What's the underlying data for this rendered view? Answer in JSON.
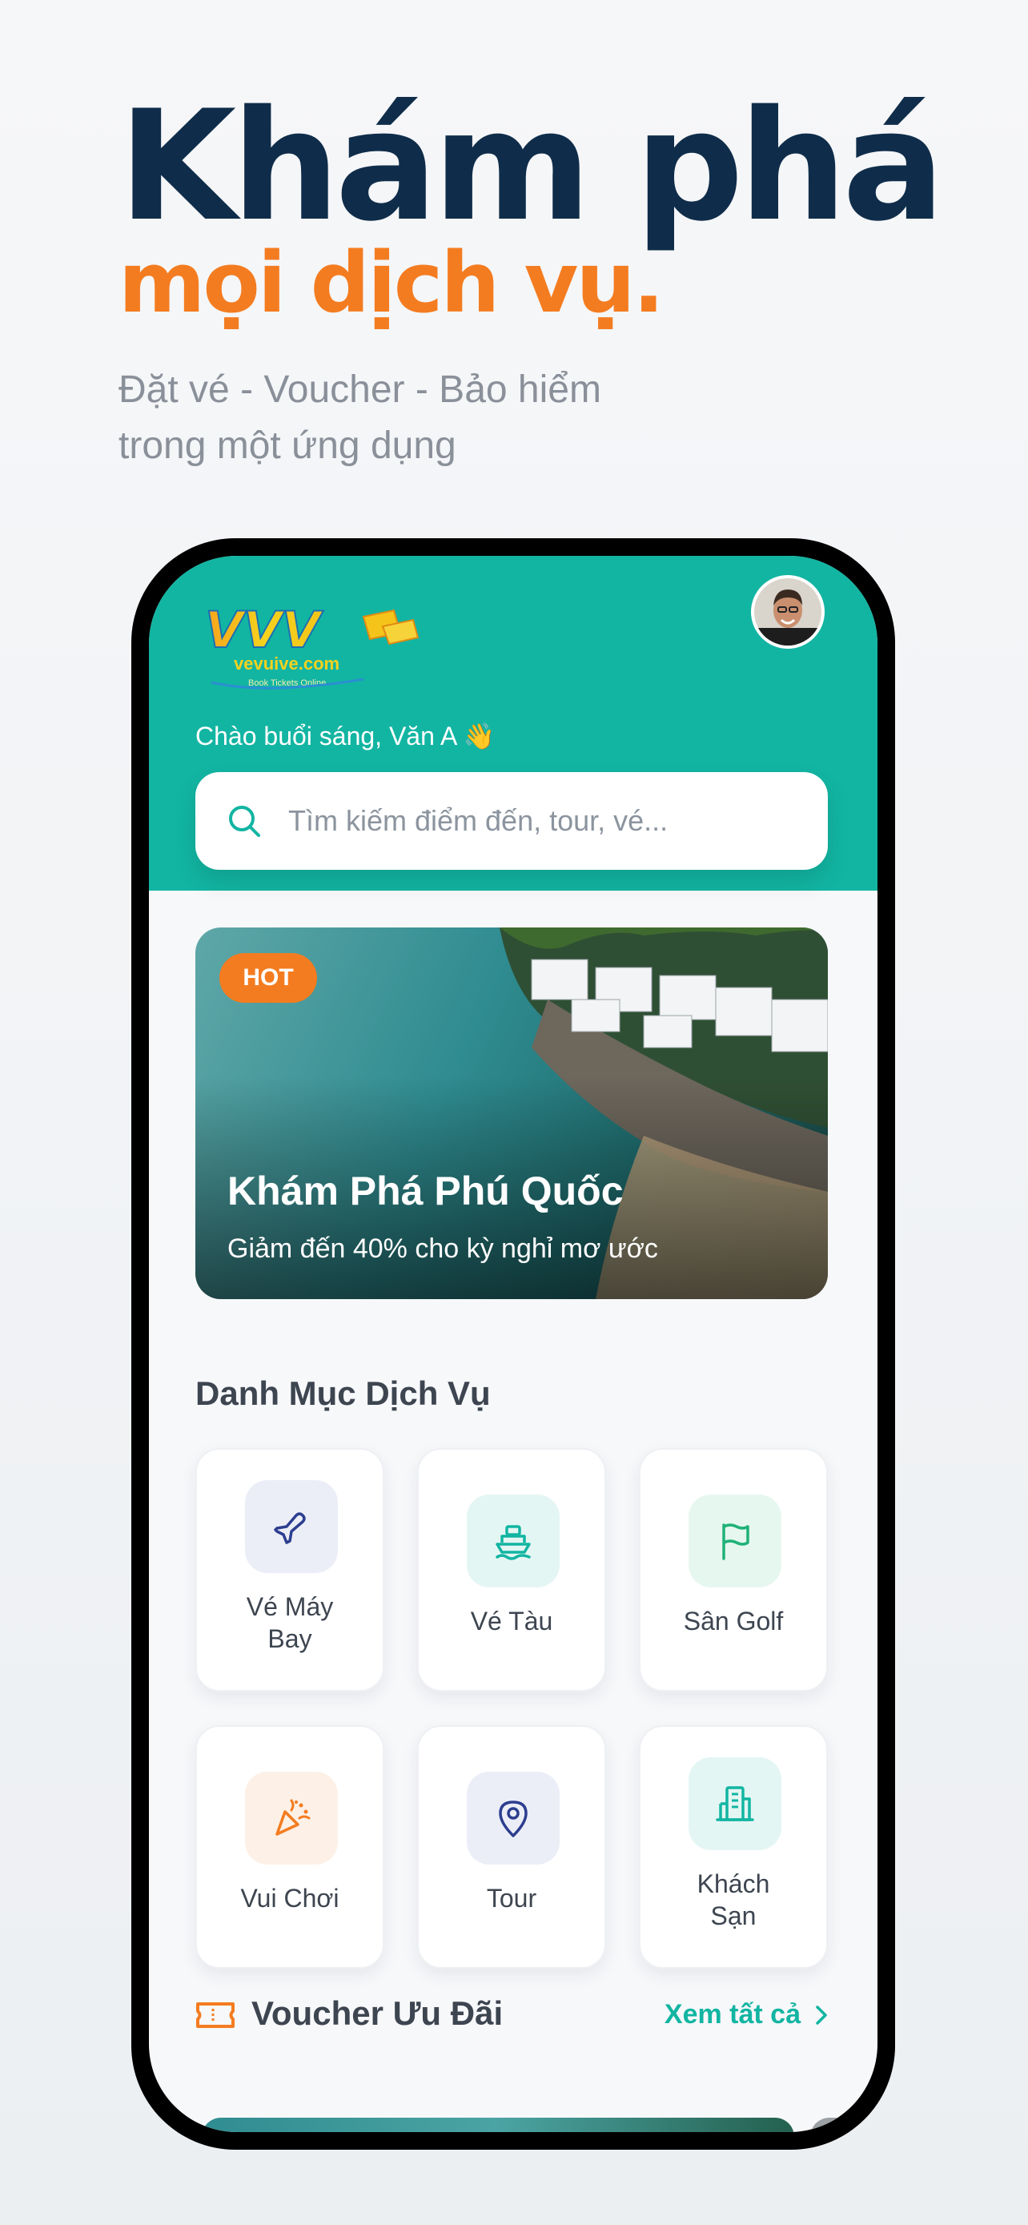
{
  "hero": {
    "title": "Khám phá",
    "subtitle": "mọi dịch vụ.",
    "description_line1": "Đặt vé - Voucher - Bảo hiểm",
    "description_line2": "trong một ứng dụng"
  },
  "app": {
    "logo_text": "VVV",
    "logo_brand": "vevuive.com",
    "logo_tagline": "Book Tickets Online",
    "greeting": "Chào buổi sáng, Văn A 👋",
    "search_placeholder": "Tìm kiếm điểm đến, tour, vé...",
    "banner": {
      "badge": "HOT",
      "title": "Khám Phá Phú Quốc",
      "subtitle": "Giảm đến 40% cho kỳ nghỉ mơ ước"
    },
    "categories_title": "Danh Mục Dịch Vụ",
    "categories": [
      {
        "label_line1": "Vé Máy",
        "label_line2": "Bay",
        "icon": "airplane-icon",
        "tile_color": "#eceef7",
        "icon_color": "#2c3e8f"
      },
      {
        "label_line1": "Vé Tàu",
        "label_line2": "",
        "icon": "ship-icon",
        "tile_color": "#e4f6f3",
        "icon_color": "#12b5a2"
      },
      {
        "label_line1": "Sân Golf",
        "label_line2": "",
        "icon": "flag-icon",
        "tile_color": "#e6f7ef",
        "icon_color": "#1fb277"
      },
      {
        "label_line1": "Vui Chơi",
        "label_line2": "",
        "icon": "party-popper-icon",
        "tile_color": "#fdf0e6",
        "icon_color": "#f47c20"
      },
      {
        "label_line1": "Tour",
        "label_line2": "",
        "icon": "map-pin-icon",
        "tile_color": "#eceef7",
        "icon_color": "#2c3e8f"
      },
      {
        "label_line1": "Khách",
        "label_line2": "Sạn",
        "icon": "building-icon",
        "tile_color": "#e4f6f3",
        "icon_color": "#12b5a2"
      }
    ],
    "voucher_title": "Voucher Ưu Đãi",
    "voucher_see_all": "Xem tất cả",
    "colors": {
      "primary": "#12b5a2",
      "accent": "#f47c20",
      "navy": "#0f2d4a"
    }
  }
}
